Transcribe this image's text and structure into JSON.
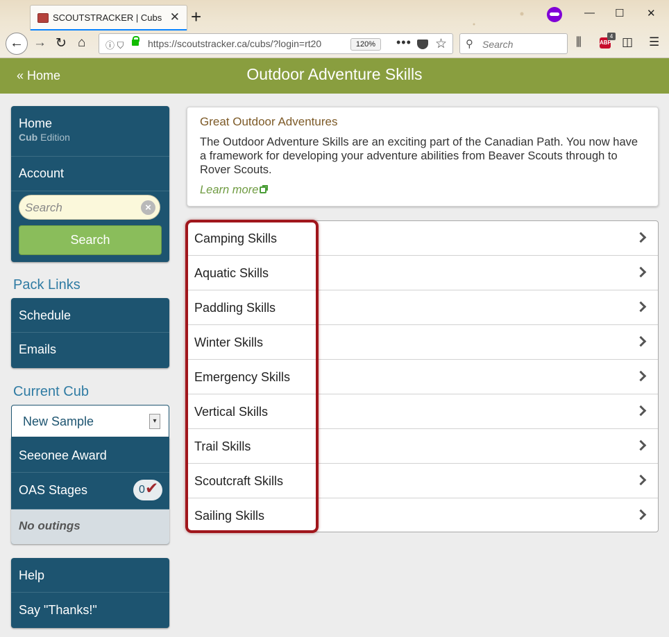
{
  "browser": {
    "tab_title": "SCOUTSTRACKER | Cubs",
    "tab_close": "✕",
    "new_tab": "+",
    "url": "https://scoutstracker.ca/cubs/?login=rt20",
    "zoom": "120%",
    "search_placeholder": "Search",
    "abp_badge": "4"
  },
  "header": {
    "home_link": "« Home",
    "title": "Outdoor Adventure Skills"
  },
  "sidebar": {
    "nav": {
      "home": "Home",
      "edition_prefix": "Cub",
      "edition_suffix": " Edition",
      "account": "Account"
    },
    "search": {
      "placeholder": "Search",
      "button": "Search"
    },
    "pack_links": {
      "heading": "Pack Links",
      "items": [
        "Schedule",
        "Emails"
      ]
    },
    "current_cub": {
      "heading": "Current Cub",
      "selected": "New Sample",
      "seeonee": "Seeonee Award",
      "oas_label": "OAS Stages",
      "oas_count": "0",
      "no_outings": "No outings"
    },
    "help": {
      "items": [
        "Help",
        "Say \"Thanks!\""
      ]
    }
  },
  "info": {
    "title": "Great Outdoor Adventures",
    "body": "The Outdoor Adventure Skills are an exciting part of the Canadian Path. You now have a framework for developing your adventure abilities from Beaver Scouts through to Rover Scouts.",
    "learn_more": "Learn more"
  },
  "skills": [
    "Camping Skills",
    "Aquatic Skills",
    "Paddling Skills",
    "Winter Skills",
    "Emergency Skills",
    "Vertical Skills",
    "Trail Skills",
    "Scoutcraft Skills",
    "Sailing Skills"
  ],
  "colors": {
    "header_green": "#899e3f",
    "panel_blue": "#1d5470",
    "search_button_green": "#8abd5b",
    "highlight_red": "#a0161c"
  }
}
